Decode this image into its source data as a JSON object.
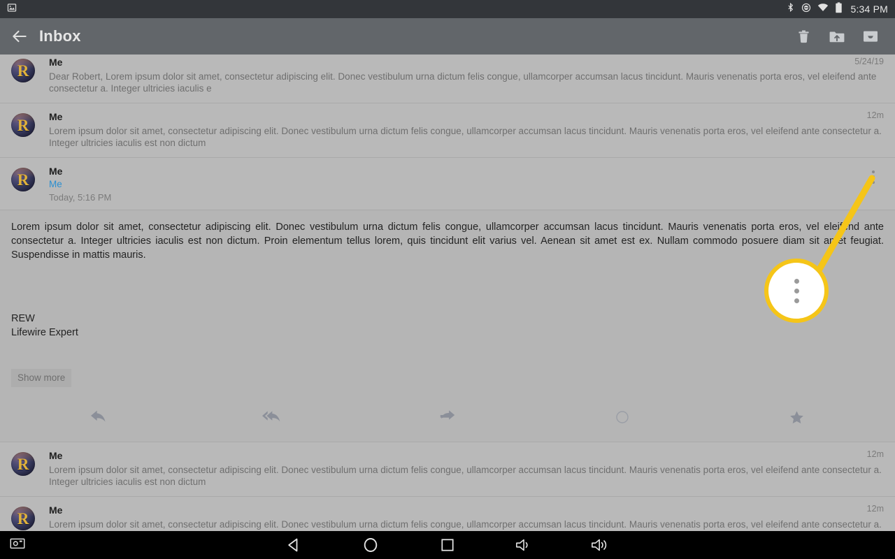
{
  "statusbar": {
    "time": "5:34 PM",
    "icons": [
      "gallery-icon",
      "bluetooth-icon",
      "do-not-disturb-icon",
      "wifi-icon",
      "battery-icon"
    ]
  },
  "appbar": {
    "back_label": "back-arrow",
    "title": "Inbox",
    "actions": [
      {
        "name": "delete-button",
        "label": "Delete"
      },
      {
        "name": "move-to-folder-button",
        "label": "Move to folder"
      },
      {
        "name": "archive-button",
        "label": "Archive"
      }
    ]
  },
  "messages": [
    {
      "sender": "Me",
      "time": "5/24/19",
      "snippet": "Dear Robert, Lorem ipsum dolor sit amet, consectetur adipiscing elit. Donec vestibulum urna dictum felis congue, ullamcorper accumsan lacus tincidunt. Mauris venenatis porta eros, vel eleifend ante consectetur a. Integer ultricies iaculis e",
      "avatar": "R"
    },
    {
      "sender": "Me",
      "time": "12m",
      "snippet": "Lorem ipsum dolor sit amet, consectetur adipiscing elit. Donec vestibulum urna dictum felis congue, ullamcorper accumsan lacus tincidunt. Mauris venenatis porta eros, vel eleifend ante consectetur a. Integer ultricies iaculis est non dictum",
      "avatar": "R"
    }
  ],
  "expanded": {
    "sender": "Me",
    "recipient": "Me",
    "date": "Today, 5:16 PM",
    "avatar": "R",
    "overflow_label": "More options",
    "body": "Lorem ipsum dolor sit amet, consectetur adipiscing elit. Donec vestibulum urna dictum felis congue, ullamcorper accumsan lacus tincidunt. Mauris venenatis porta eros, vel eleifend ante consectetur a. Integer ultricies iaculis est non dictum. Proin elementum tellus lorem, quis tincidunt elit varius vel. Aenean sit amet est ex. Nullam commodo posuere diam sit amet feugiat. Suspendisse in mattis mauris.",
    "signature_line1": "REW",
    "signature_line2": "Lifewire Expert",
    "show_more_label": "Show more",
    "actions": [
      {
        "name": "reply-button",
        "label": "Reply"
      },
      {
        "name": "reply-all-button",
        "label": "Reply all"
      },
      {
        "name": "forward-button",
        "label": "Forward"
      },
      {
        "name": "mark-unread-button",
        "label": "Mark unread"
      },
      {
        "name": "star-button",
        "label": "Star"
      }
    ]
  },
  "messages_below": [
    {
      "sender": "Me",
      "time": "12m",
      "snippet": "Lorem ipsum dolor sit amet, consectetur adipiscing elit. Donec vestibulum urna dictum felis congue, ullamcorper accumsan lacus tincidunt. Mauris venenatis porta eros, vel eleifend ante consectetur a. Integer ultricies iaculis est non dictum",
      "avatar": "R"
    },
    {
      "sender": "Me",
      "time": "12m",
      "snippet": "Lorem ipsum dolor sit amet, consectetur adipiscing elit. Donec vestibulum urna dictum felis congue, ullamcorper accumsan lacus tincidunt. Mauris venenatis porta eros, vel eleifend ante consectetur a. Integer ultricies iaculis est non dictum",
      "avatar": "R"
    }
  ],
  "callout": {
    "target": "overflow-menu-button",
    "highlight_color": "#f5c518",
    "bubble_icon": "more-vertical-icon"
  },
  "navbar": {
    "buttons": [
      {
        "name": "screenshot-button",
        "label": "Screenshot"
      },
      {
        "name": "back-button",
        "label": "Back"
      },
      {
        "name": "home-button",
        "label": "Home"
      },
      {
        "name": "recents-button",
        "label": "Recent apps"
      },
      {
        "name": "volume-down-button",
        "label": "Volume down"
      },
      {
        "name": "volume-up-button",
        "label": "Volume up"
      }
    ]
  }
}
